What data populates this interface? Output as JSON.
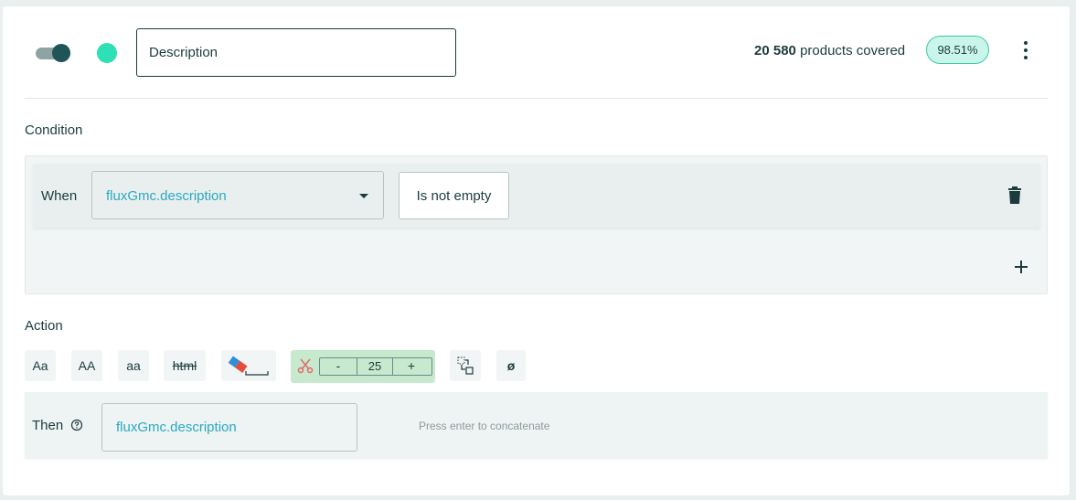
{
  "header": {
    "rule_name": "Description",
    "coverage_count": "20 580",
    "coverage_suffix": "products covered",
    "coverage_percent": "98.51%",
    "enabled": true,
    "status_color": "#2ee0b5"
  },
  "condition": {
    "section_label": "Condition",
    "when_label": "When",
    "field": "fluxGmc.description",
    "operator": "Is not empty",
    "icons": {
      "delete": "trash-icon",
      "add": "plus-icon",
      "field_dropdown": "caret-down-icon"
    }
  },
  "action": {
    "section_label": "Action",
    "tools": {
      "capitalize": "Aa",
      "uppercase": "AA",
      "lowercase": "aa",
      "strip_html": "html",
      "erase_spaces": "eraser-icon",
      "truncate": "scissors-icon",
      "replace": "replace-icon",
      "empty": "ø"
    },
    "truncate": {
      "minus": "-",
      "value": "25",
      "plus": "+"
    },
    "then_label": "Then",
    "then_value": "fluxGmc.description",
    "hint": "Press enter to concatenate"
  },
  "colors": {
    "primary_dark": "#1c3b3d",
    "accent_teal": "#2aa9c1",
    "badge_bg": "#c9f5ea",
    "trim_bg": "#c7e9cd"
  }
}
